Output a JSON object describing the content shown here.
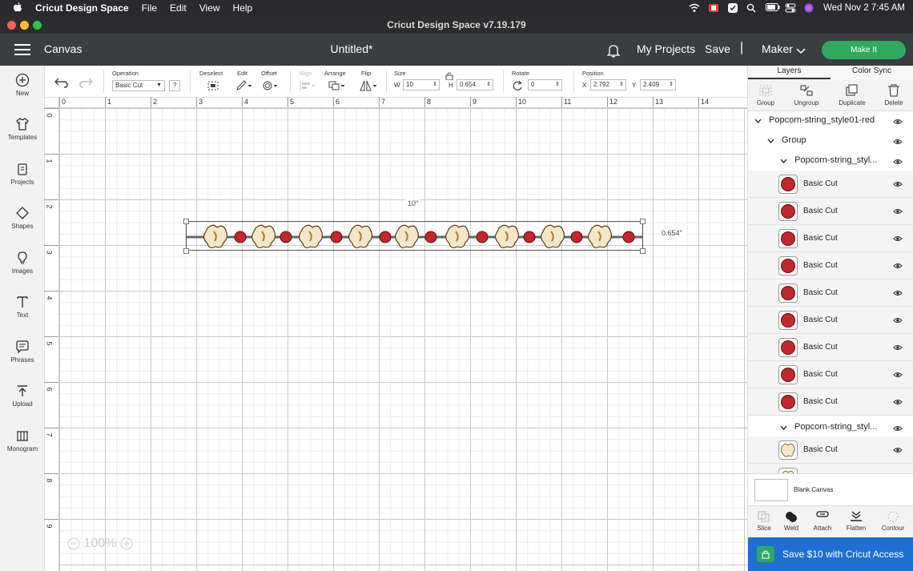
{
  "menubar": {
    "app": "Cricut Design Space",
    "items": [
      "File",
      "Edit",
      "View",
      "Help"
    ],
    "clock": "Wed Nov 2  7:45 AM"
  },
  "window": {
    "title": "Cricut Design Space  v7.19.179"
  },
  "header": {
    "section": "Canvas",
    "doc_title": "Untitled*",
    "my_projects": "My Projects",
    "save": "Save",
    "divider": "|",
    "machine": "Maker",
    "make_it": "Make It"
  },
  "toolbar": {
    "operation_label": "Operation",
    "operation_value": "Basic Cut",
    "help": "?",
    "deselect": "Deselect",
    "edit": "Edit",
    "offset": "Offset",
    "align": "Align",
    "arrange": "Arrange",
    "flip": "Flip",
    "size_label": "Size",
    "w_label": "W",
    "w_value": "10",
    "h_label": "H",
    "h_value": "0.654",
    "rotate_label": "Rotate",
    "rotate_value": "0",
    "position_label": "Position",
    "x_label": "X",
    "x_value": "2.792",
    "y_label": "Y",
    "y_value": "2.409"
  },
  "leftbar": [
    "New",
    "Templates",
    "Projects",
    "Shapes",
    "Images",
    "Text",
    "Phrases",
    "Upload",
    "Monogram"
  ],
  "rulers": {
    "h": [
      "0",
      "1",
      "2",
      "3",
      "4",
      "5",
      "6",
      "7",
      "8",
      "9",
      "10",
      "11",
      "12",
      "13",
      "14"
    ],
    "v": [
      "0",
      "1",
      "2",
      "3",
      "4",
      "5",
      "6",
      "7",
      "8",
      "9"
    ]
  },
  "canvas": {
    "width_dim": "10\"",
    "height_dim": "0.654\"",
    "zoom": "100%"
  },
  "rpanel": {
    "tabs": [
      "Layers",
      "Color Sync"
    ],
    "actions": [
      "Group",
      "Ungroup",
      "Duplicate",
      "Delete"
    ],
    "tree": {
      "root": "Popcorn-string_style01-red",
      "group": "Group",
      "sub1": "Popcorn-string_styl...",
      "sub2": "Popcorn-string_styl..."
    },
    "layer_label": "Basic Cut",
    "blank_canvas": "Blank Canvas",
    "bottom_actions": [
      "Slice",
      "Weld",
      "Attach",
      "Flatten",
      "Contour"
    ],
    "access": "Save $10 with Cricut Access"
  },
  "colors": {
    "red_layer": "#c1272d",
    "popcorn": "#f6e6c8",
    "make_it": "#2eaa5f",
    "access": "#1f6fd1"
  }
}
